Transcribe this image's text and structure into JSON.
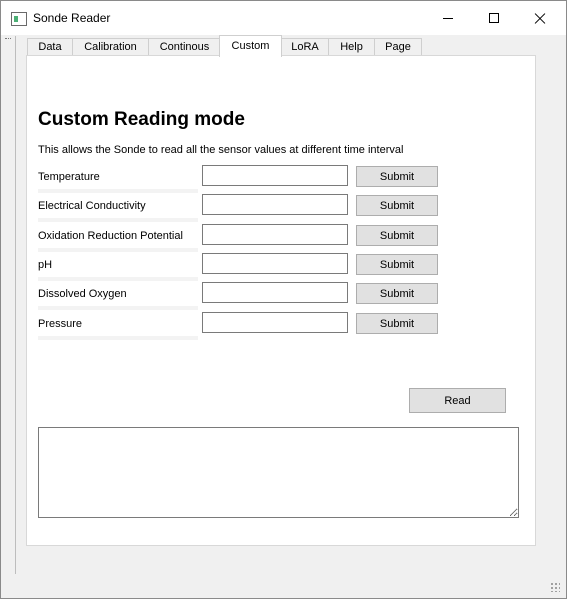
{
  "window": {
    "title": "Sonde Reader"
  },
  "tabs": [
    {
      "label": "Data"
    },
    {
      "label": "Calibration"
    },
    {
      "label": "Continous"
    },
    {
      "label": "Custom",
      "active": true
    },
    {
      "label": "LoRA"
    },
    {
      "label": "Help"
    },
    {
      "label": "Page"
    }
  ],
  "custom": {
    "heading": "Custom Reading mode",
    "description": "This allows the Sonde to read all the sensor values at different time interval",
    "rows": [
      {
        "label": "Temperature",
        "value": "",
        "button": "Submit"
      },
      {
        "label": "Electrical Conductivity",
        "value": "",
        "button": "Submit"
      },
      {
        "label": "Oxidation Reduction Potential",
        "value": "",
        "button": "Submit"
      },
      {
        "label": "pH",
        "value": "",
        "button": "Submit"
      },
      {
        "label": "Dissolved Oxygen",
        "value": "",
        "button": "Submit"
      },
      {
        "label": "Pressure",
        "value": "",
        "button": "Submit"
      }
    ],
    "read_button": "Read",
    "output_text": ""
  }
}
